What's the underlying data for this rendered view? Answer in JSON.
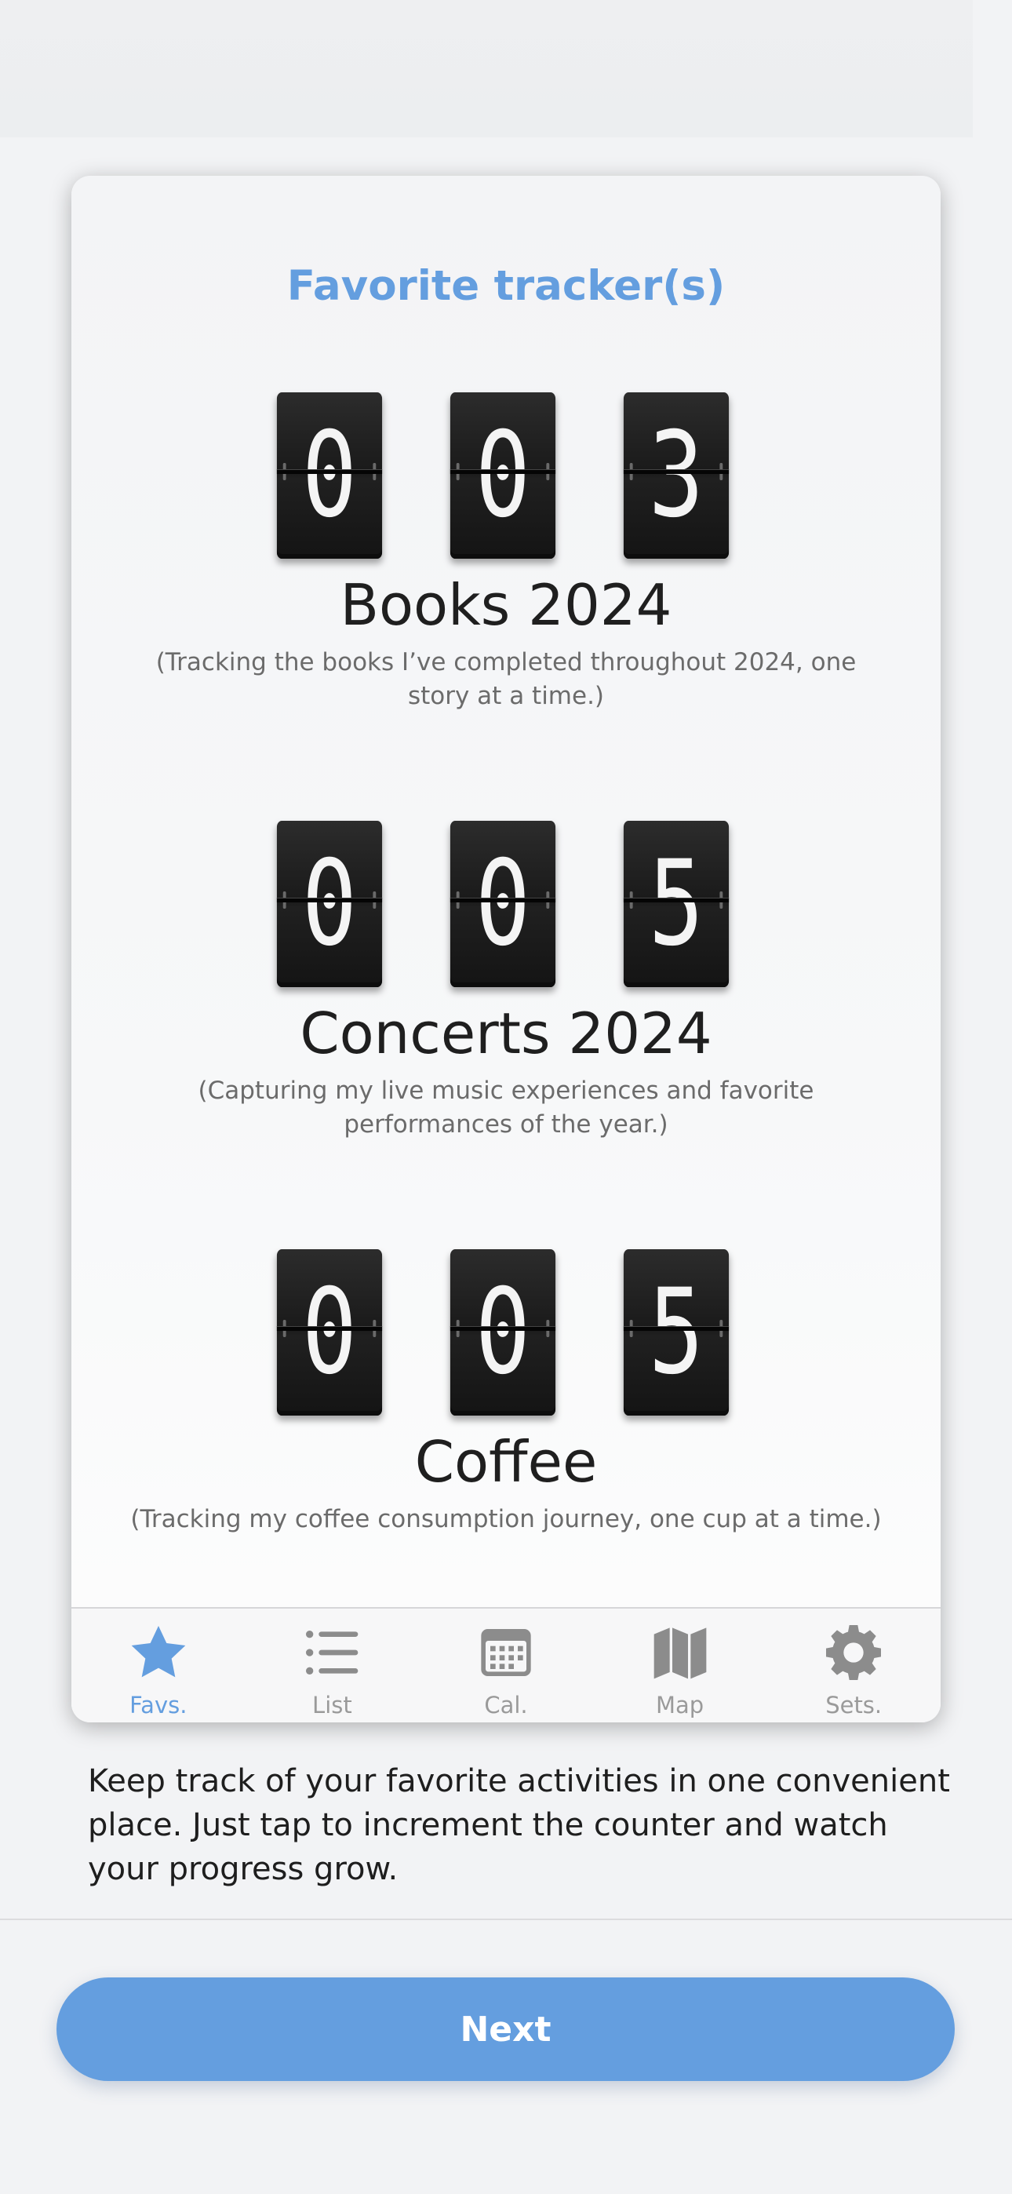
{
  "card": {
    "title": "Favorite tracker(s)"
  },
  "trackers": [
    {
      "digits": [
        "0",
        "0",
        "3"
      ],
      "name": "Books 2024",
      "description": "(Tracking the books I’ve completed throughout 2024, one story at a time.)"
    },
    {
      "digits": [
        "0",
        "0",
        "5"
      ],
      "name": "Concerts 2024",
      "description": "(Capturing my live music experiences and favorite performances of the year.)"
    },
    {
      "digits": [
        "0",
        "0",
        "5"
      ],
      "name": "Coffee",
      "description": "(Tracking my coffee consumption journey, one cup at a time.)"
    }
  ],
  "tabbar": {
    "tabs": [
      {
        "label": "Favs.",
        "icon": "star-icon",
        "active": true
      },
      {
        "label": "List",
        "icon": "list-icon",
        "active": false
      },
      {
        "label": "Cal.",
        "icon": "calendar-icon",
        "active": false
      },
      {
        "label": "Map",
        "icon": "map-icon",
        "active": false
      },
      {
        "label": "Sets.",
        "icon": "gear-icon",
        "active": false
      }
    ]
  },
  "onboarding": {
    "text": "Keep track of your favorite activities in one convenient place. Just tap to increment the counter and watch your progress grow.",
    "next_label": "Next"
  },
  "colors": {
    "accent": "#649edf",
    "inactive": "#9a9a9a",
    "flip_card": "#1e1e1e"
  }
}
